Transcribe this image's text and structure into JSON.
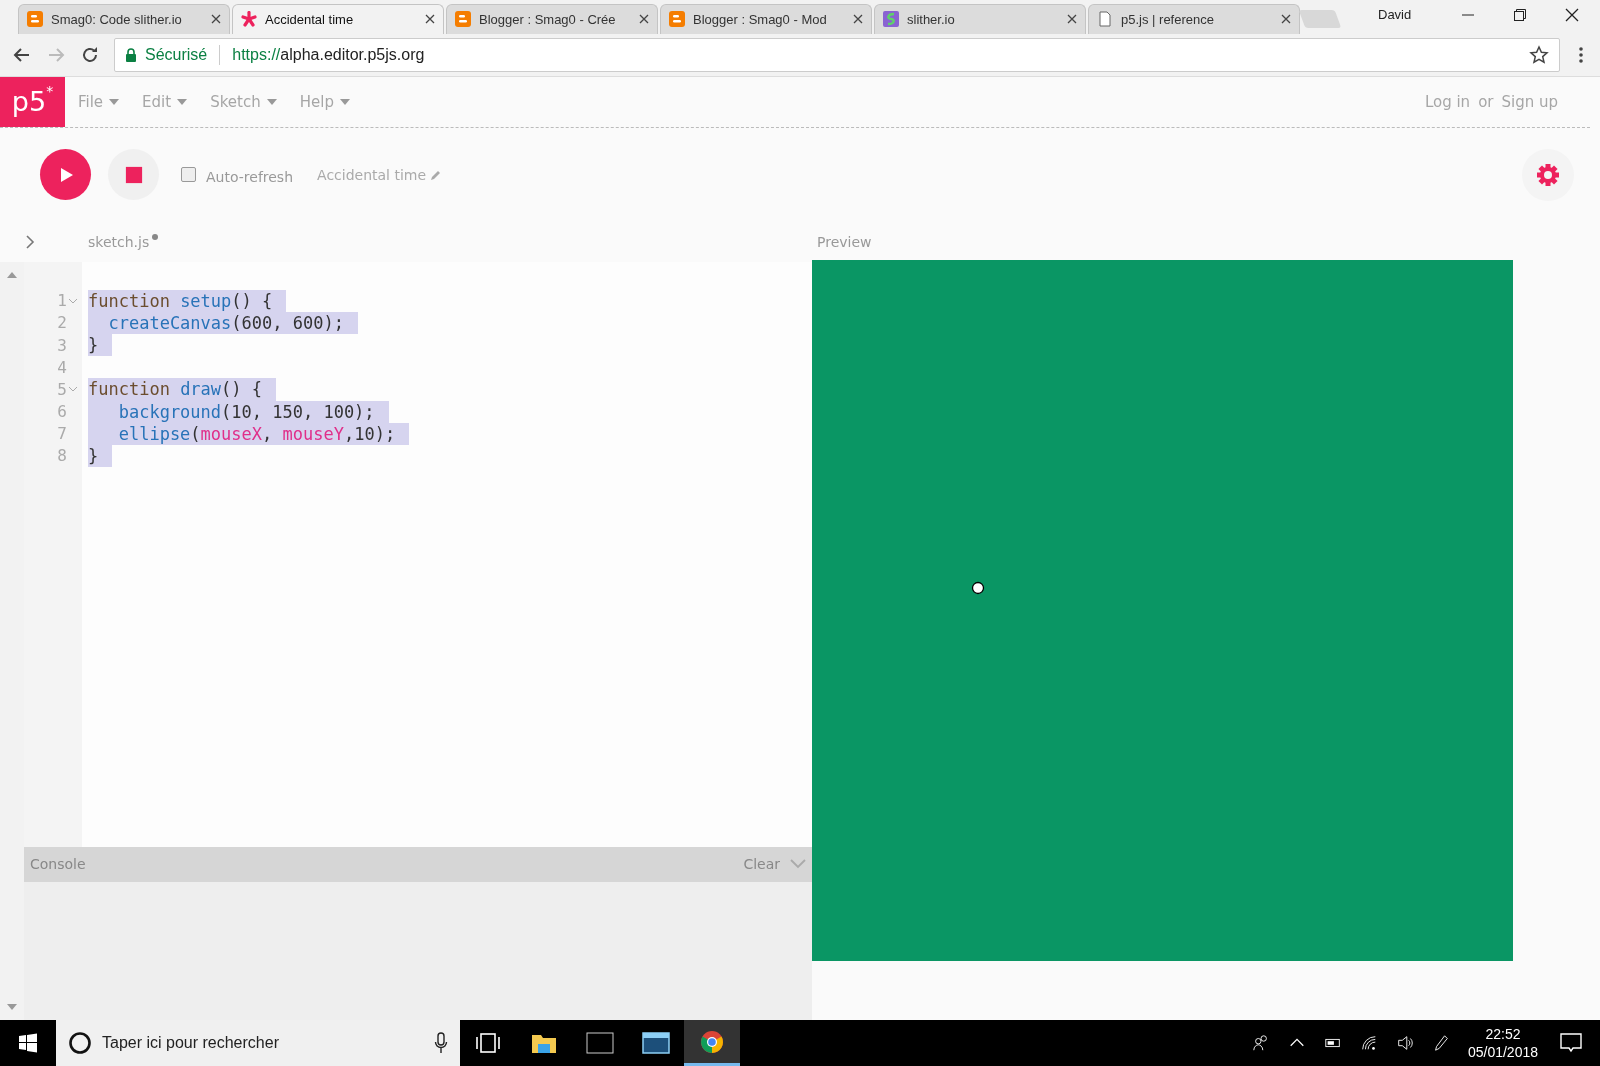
{
  "browser": {
    "tabs": [
      {
        "title": "Smag0: Code slither.io",
        "kind": "blogger",
        "selected": false
      },
      {
        "title": "Accidental time",
        "kind": "p5",
        "selected": true
      },
      {
        "title": "Blogger : Smag0 - Crée",
        "kind": "blogger",
        "selected": false
      },
      {
        "title": "Blogger : Smag0 - Mod",
        "kind": "blogger",
        "selected": false
      },
      {
        "title": "slither.io",
        "kind": "slither",
        "selected": false
      },
      {
        "title": "p5.js | reference",
        "kind": "page",
        "selected": false
      }
    ],
    "profile": "David",
    "security": "Sécurisé",
    "url_scheme": "https://",
    "url_host": "alpha.editor.p5js.org"
  },
  "app": {
    "logo": "p5",
    "logo_mark": "*",
    "menu": [
      {
        "label": "File"
      },
      {
        "label": "Edit"
      },
      {
        "label": "Sketch"
      },
      {
        "label": "Help"
      }
    ],
    "auth": {
      "login": "Log in",
      "or": "or",
      "signup": "Sign up"
    },
    "toolbar": {
      "auto_refresh": {
        "label": "Auto-refresh",
        "checked": false
      },
      "sketch_name": "Accidental time"
    },
    "file": {
      "name": "sketch.js",
      "unsaved": true
    },
    "preview_label": "Preview",
    "code": [
      {
        "number": "1",
        "foldable": true,
        "selected": true,
        "tokens": [
          {
            "text": "function ",
            "kind": "keyword"
          },
          {
            "text": "setup",
            "kind": "def"
          },
          {
            "text": "() {",
            "kind": "plain"
          }
        ]
      },
      {
        "number": "2",
        "foldable": false,
        "selected": true,
        "tokens": [
          {
            "text": "  createCanvas",
            "kind": "def"
          },
          {
            "text": "(600, 600);",
            "kind": "plain"
          }
        ]
      },
      {
        "number": "3",
        "foldable": false,
        "selected": true,
        "tokens": [
          {
            "text": "}",
            "kind": "plain"
          }
        ]
      },
      {
        "number": "4",
        "foldable": false
      },
      {
        "number": "5",
        "foldable": true,
        "selected": true,
        "tokens": [
          {
            "text": "function ",
            "kind": "keyword"
          },
          {
            "text": "draw",
            "kind": "def"
          },
          {
            "text": "() {",
            "kind": "plain"
          }
        ]
      },
      {
        "number": "6",
        "foldable": false,
        "selected": true,
        "tokens": [
          {
            "text": "   background",
            "kind": "def"
          },
          {
            "text": "(10, 150, 100);",
            "kind": "plain"
          }
        ]
      },
      {
        "number": "7",
        "foldable": false,
        "selected": true,
        "tokens": [
          {
            "text": "   ellipse",
            "kind": "def"
          },
          {
            "text": "(",
            "kind": "plain"
          },
          {
            "text": "mouseX",
            "kind": "var"
          },
          {
            "text": ", ",
            "kind": "plain"
          },
          {
            "text": "mouseY",
            "kind": "var"
          },
          {
            "text": ",10);",
            "kind": "plain"
          }
        ]
      },
      {
        "number": "8",
        "foldable": false,
        "selected": true,
        "tokens": [
          {
            "text": "}",
            "kind": "plain"
          }
        ]
      }
    ],
    "console": {
      "title": "Console",
      "clear": "Clear"
    }
  },
  "taskbar": {
    "search_placeholder": "Taper ici pour rechercher",
    "apps": [
      {
        "kind": "task-view",
        "selected": false
      },
      {
        "kind": "folder",
        "selected": false
      },
      {
        "kind": "terminal",
        "selected": false
      },
      {
        "kind": "window",
        "selected": false
      },
      {
        "kind": "chrome",
        "selected": true
      }
    ],
    "time": "22:52",
    "date": "05/01/2018"
  }
}
